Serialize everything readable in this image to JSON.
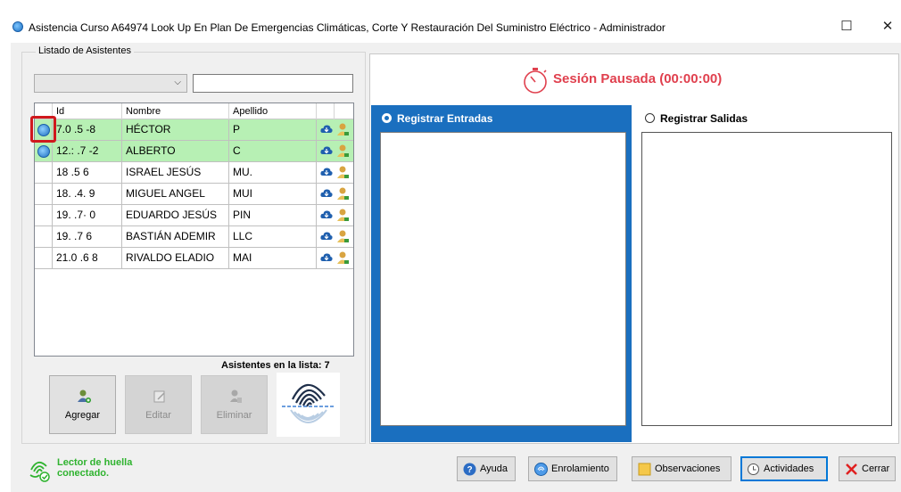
{
  "window": {
    "title": "Asistencia Curso A64974 Look Up En Plan De Emergencias Climáticas, Corte Y Restauración Del Suministro Eléctrico - Administrador",
    "maximize_glyph": "☐",
    "close_glyph": "✕"
  },
  "attendees": {
    "group_title": "Listado de Asistentes",
    "combo_value": "",
    "search_value": "",
    "search_placeholder": "",
    "columns": [
      "Id",
      "Nombre",
      "Apellido"
    ],
    "rows": [
      {
        "id": "7.0  .5  -8",
        "nombre": "HÉCTOR",
        "apellido": "P",
        "selected": true,
        "fingerprint": true
      },
      {
        "id": "12.:  .7  -2",
        "nombre": "ALBERTO",
        "apellido": "C",
        "selected": true,
        "fingerprint": true
      },
      {
        "id": "18    .5   6",
        "nombre": "ISRAEL JESÚS",
        "apellido": "MU.",
        "selected": false,
        "fingerprint": false
      },
      {
        "id": "18.  .4.  9",
        "nombre": "MIGUEL ANGEL",
        "apellido": "MUI",
        "selected": false,
        "fingerprint": false
      },
      {
        "id": "19.   .7·  0",
        "nombre": "EDUARDO JESÚS",
        "apellido": "PIN",
        "selected": false,
        "fingerprint": false
      },
      {
        "id": "19.   .7   6",
        "nombre": "BASTIÁN ADEMIR",
        "apellido": "LLC",
        "selected": false,
        "fingerprint": false
      },
      {
        "id": "21.0  .6   8",
        "nombre": "RIVALDO ELADIO",
        "apellido": "MAI",
        "selected": false,
        "fingerprint": false
      }
    ],
    "row_icons": [
      "cloud-download-icon",
      "user-key-icon"
    ],
    "count_label": "Asistentes en la lista: 7"
  },
  "actions": {
    "add_label": "Agregar",
    "edit_label": "Editar",
    "delete_label": "Eliminar"
  },
  "session": {
    "status": "Sesión Pausada (00:00:00)",
    "status_color": "#e0404e",
    "entradas_label": "Registrar Entradas",
    "salidas_label": "Registrar Salidas",
    "entradas_color": "#1a6fbf"
  },
  "reader": {
    "status_line1": "Lector de huella",
    "status_line2": "conectado.",
    "status_color": "#2fb32f"
  },
  "footer": {
    "help_label": "Ayuda",
    "enroll_label": "Enrolamiento",
    "observations_label": "Observaciones",
    "activities_label": "Actividades",
    "close_label": "Cerrar"
  }
}
